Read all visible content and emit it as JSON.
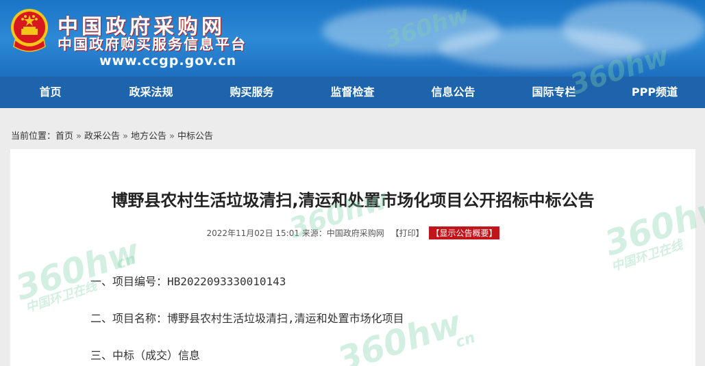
{
  "header": {
    "brand_line1": "中国政府采购网",
    "brand_line2": "中国政府购买服务信息平台",
    "url": "www.ccgp.gov.cn"
  },
  "nav": {
    "items": [
      "首页",
      "政采法规",
      "购买服务",
      "监督检查",
      "信息公告",
      "国际专栏",
      "PPP频道"
    ]
  },
  "breadcrumb": {
    "prefix": "当前位置：",
    "items": [
      "首页",
      "政采公告",
      "地方公告",
      "中标公告"
    ],
    "separator": "»"
  },
  "article": {
    "title": "博野县农村生活垃圾清扫,清运和处置市场化项目公开招标中标公告",
    "date": "2022年11月02日 15:01",
    "source": "来源：中国政府采购网",
    "print_label": "【打印】",
    "summary_label": "【显示公告概要】",
    "rows": [
      {
        "label": "一、项目编号：",
        "value": "HB2022093330010143"
      },
      {
        "label": "二、项目名称：",
        "value": "博野县农村生活垃圾清扫,清运和处置市场化项目"
      },
      {
        "label": "三、中标（成交）信息",
        "value": ""
      }
    ]
  },
  "watermark": {
    "brand": "360hw",
    "tagline": "中国环卫在线",
    "cn_badge": "cn"
  },
  "colors": {
    "banner": "#1a74c6",
    "nav": "#1e64ad",
    "summary_button": "#c0161b",
    "watermark": "#82d2aa"
  }
}
